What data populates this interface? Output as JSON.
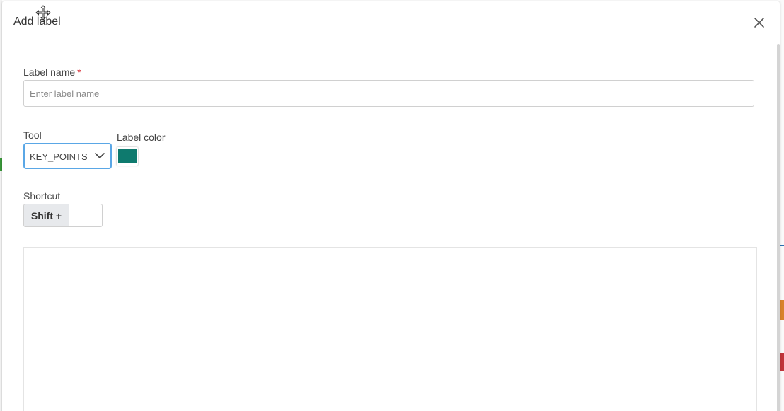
{
  "dialog": {
    "title": "Add label",
    "close_icon": "close-icon",
    "move_icon": "move-icon"
  },
  "form": {
    "label_name": {
      "label": "Label name",
      "required_mark": "*",
      "value": "",
      "placeholder": "Enter label name"
    },
    "tool": {
      "label": "Tool",
      "selected": "KEY_POINTS",
      "icon": "chevron-down-icon"
    },
    "label_color": {
      "label": "Label color",
      "value": "#0e7a6e"
    },
    "shortcut": {
      "label": "Shortcut",
      "modifier": "Shift +",
      "value": ""
    }
  },
  "colors": {
    "accent": "#5aa7e6",
    "required": "#d9363e"
  }
}
